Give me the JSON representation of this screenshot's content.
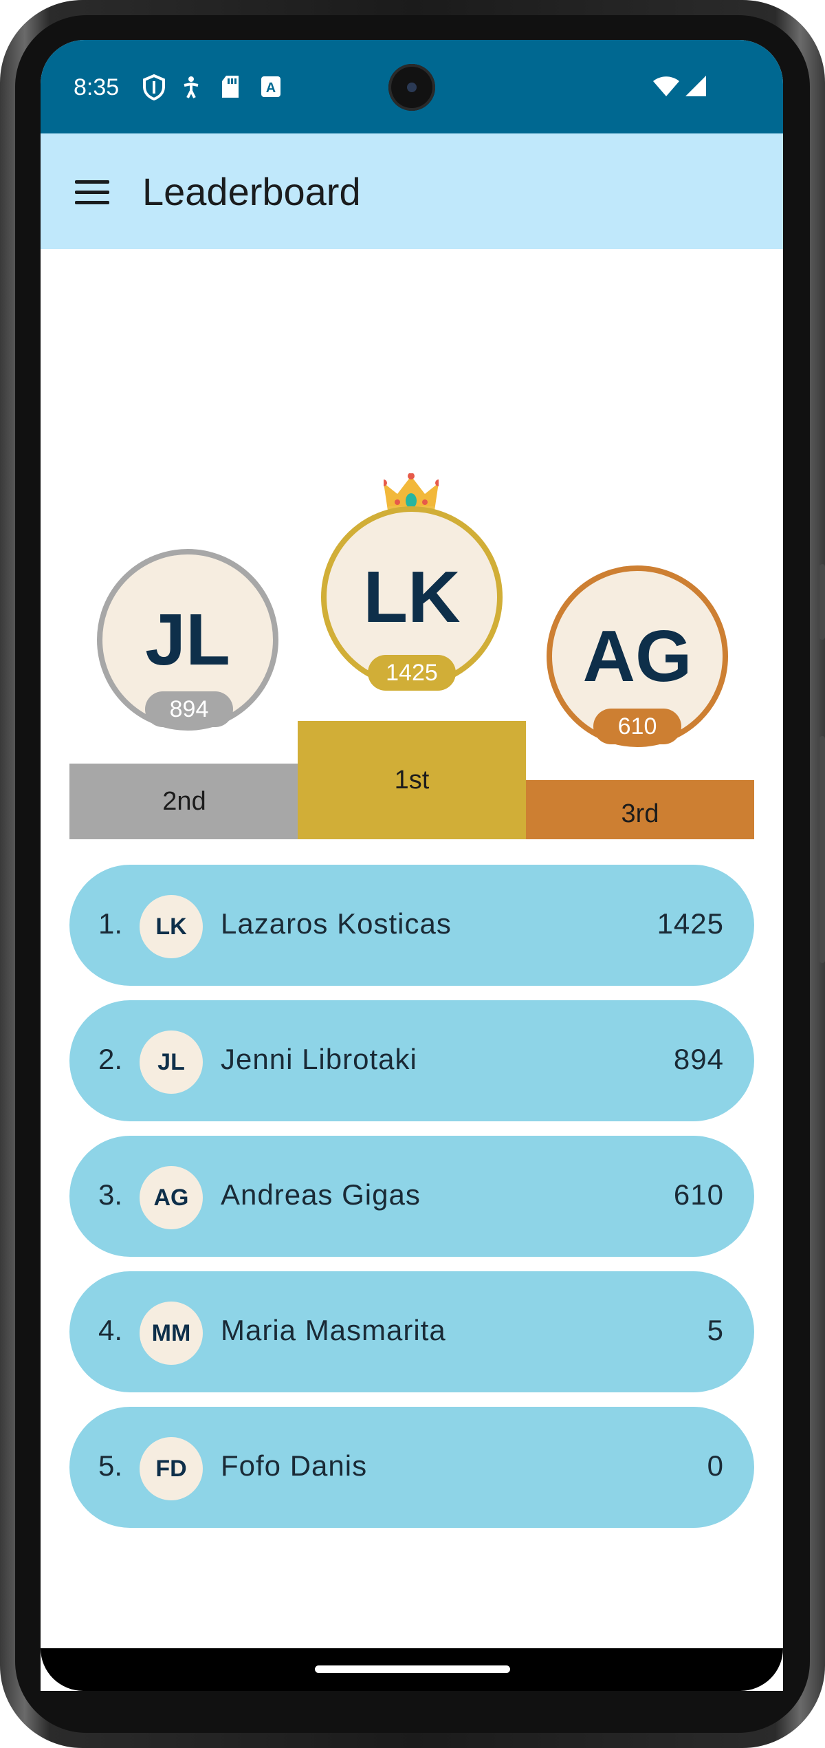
{
  "status_bar": {
    "time": "8:35",
    "left_icons": [
      "shield-icon",
      "accessibility-icon",
      "sd-card-icon",
      "font-download-icon"
    ],
    "right_icons": [
      "wifi-icon",
      "signal-icon"
    ]
  },
  "app_bar": {
    "menu_icon": "menu-icon",
    "title": "Leaderboard"
  },
  "podium": {
    "first": {
      "initials": "LK",
      "score": "1425",
      "place": "1st",
      "color": "#d1ae37",
      "crown_icon": "crown-icon"
    },
    "second": {
      "initials": "JL",
      "score": "894",
      "place": "2nd",
      "color": "#a7a7a7"
    },
    "third": {
      "initials": "AG",
      "score": "610",
      "place": "3rd",
      "color": "#cd7f32"
    }
  },
  "leaderboard": [
    {
      "rank": "1.",
      "initials": "LK",
      "name": "Lazaros Kosticas",
      "score": "1425"
    },
    {
      "rank": "2.",
      "initials": "JL",
      "name": "Jenni Librotaki",
      "score": "894"
    },
    {
      "rank": "3.",
      "initials": "AG",
      "name": "Andreas Gigas",
      "score": "610"
    },
    {
      "rank": "4.",
      "initials": "MM",
      "name": "Maria Masmarita",
      "score": "5"
    },
    {
      "rank": "5.",
      "initials": "FD",
      "name": "Fofo Danis",
      "score": "0"
    }
  ],
  "colors": {
    "status_bar": "#006891",
    "app_bar": "#c0e8fb",
    "row_bg": "#8ed4e7",
    "avatar_bg": "#f6ede0",
    "initials_text": "#0e2f4a"
  }
}
